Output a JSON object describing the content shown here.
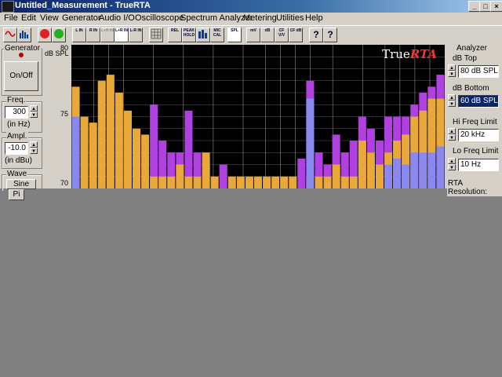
{
  "window": {
    "title": "Untitled_Measurement - TrueRTA",
    "min": "_",
    "max": "□",
    "close": "×"
  },
  "menu": [
    "File",
    "Edit",
    "View",
    "Generator",
    "Audio I/O",
    "Oscilloscope",
    "Spectrum Analyzer",
    "Metering",
    "Utilities",
    "Help"
  ],
  "toolbar": [
    {
      "name": "oscilloscope-view-button",
      "label": ""
    },
    {
      "name": "spectrum-view-button",
      "label": ""
    },
    {
      "name": "stop-button",
      "label": "STOP"
    },
    {
      "name": "go-button",
      "label": "GO"
    },
    {
      "name": "left-in-button",
      "label": "L IN"
    },
    {
      "name": "right-in-button",
      "label": "R IN"
    },
    {
      "name": "lr-in-disabled-button",
      "label": "L+R IN"
    },
    {
      "name": "lr-sum-in-button",
      "label": "L+R IN"
    },
    {
      "name": "lr-diff-in-button",
      "label": "L-R IN"
    },
    {
      "name": "grid-button",
      "label": ""
    },
    {
      "name": "rel-button",
      "label": "REL"
    },
    {
      "name": "peak-hold-button",
      "label": "PEAK HOLD"
    },
    {
      "name": "bars-button",
      "label": ""
    },
    {
      "name": "mic-cal-button",
      "label": "MIC CAL"
    },
    {
      "name": "spl-button",
      "label": "SPL"
    },
    {
      "name": "mv-button",
      "label": "mV"
    },
    {
      "name": "db-button",
      "label": "dB"
    },
    {
      "name": "cf-vv-button",
      "label": "CF V/V"
    },
    {
      "name": "cf-db-button",
      "label": "CF dB"
    },
    {
      "name": "help-button",
      "label": "?"
    },
    {
      "name": "context-help-button",
      "label": "?"
    }
  ],
  "generator": {
    "title": "Generator",
    "onoff": "On/Off",
    "freq_label": "Freq.",
    "freq_value": "300",
    "freq_unit": "(in Hz)",
    "ampl_label": "Ampl.",
    "ampl_value": "-10.0",
    "ampl_unit": "(in dBu)",
    "wave_label": "Wave",
    "wave_sine": "Sine",
    "wave_pink": "Pi"
  },
  "analyzer": {
    "title": "Analyzer",
    "db_top_label": "dB Top",
    "db_top_value": "80 dB SPL",
    "db_bottom_label": "dB Bottom",
    "db_bottom_value": "60 dB SPL",
    "hi_freq_label": "Hi Freq Limit",
    "hi_freq_value": "20 kHz",
    "lo_freq_label": "Lo Freq Limit",
    "lo_freq_value": "10 Hz",
    "resolution_label": "RTA Resolution:"
  },
  "graph": {
    "logo_a": "True",
    "logo_b": "RTA",
    "unit": "dB SPL",
    "y_ticks": [
      "80",
      "75",
      "70"
    ],
    "colors": {
      "orange": "#e8a83a",
      "purple": "#b040e0",
      "blue": "#8888ee",
      "green": "#40c040",
      "grid": "#c8c8c8"
    }
  },
  "chart_data": {
    "type": "bar",
    "ylabel": "dB SPL",
    "ylim": [
      68,
      80
    ],
    "series": [
      {
        "name": "",
        "color": "orange",
        "values": [
          76.5,
          74,
          73.5,
          77,
          77.5,
          76,
          74.5,
          73,
          72.5,
          69,
          69,
          69,
          70,
          69,
          69,
          71,
          69,
          68,
          69,
          69,
          69,
          69,
          69,
          69,
          69,
          69,
          68,
          69,
          69,
          69,
          70,
          69,
          69,
          72,
          71,
          70,
          71,
          72,
          72.5,
          74,
          74.5,
          75.5,
          75.5
        ]
      },
      {
        "name": "",
        "color": "purple",
        "values": [
          68,
          68,
          68,
          68,
          68,
          68,
          68,
          68,
          68,
          75,
          72,
          71,
          71,
          74.5,
          71,
          70.5,
          68,
          70,
          68,
          68,
          68,
          68,
          68,
          68,
          68,
          68,
          70.5,
          77,
          71,
          70,
          72.5,
          71,
          72,
          74,
          73,
          72,
          74,
          74,
          74,
          75,
          76,
          76.5,
          77.5
        ]
      },
      {
        "name": "",
        "color": "blue",
        "values": [
          74,
          68,
          68,
          68,
          68,
          68,
          68,
          68,
          68,
          68,
          68,
          68,
          68,
          68,
          68,
          68,
          68,
          68,
          68,
          68,
          68,
          68,
          68,
          68,
          68,
          68,
          68,
          75.5,
          68,
          68,
          68,
          68,
          68,
          68,
          68,
          68,
          70,
          70.5,
          70,
          71,
          71,
          71,
          71.5
        ]
      }
    ]
  }
}
